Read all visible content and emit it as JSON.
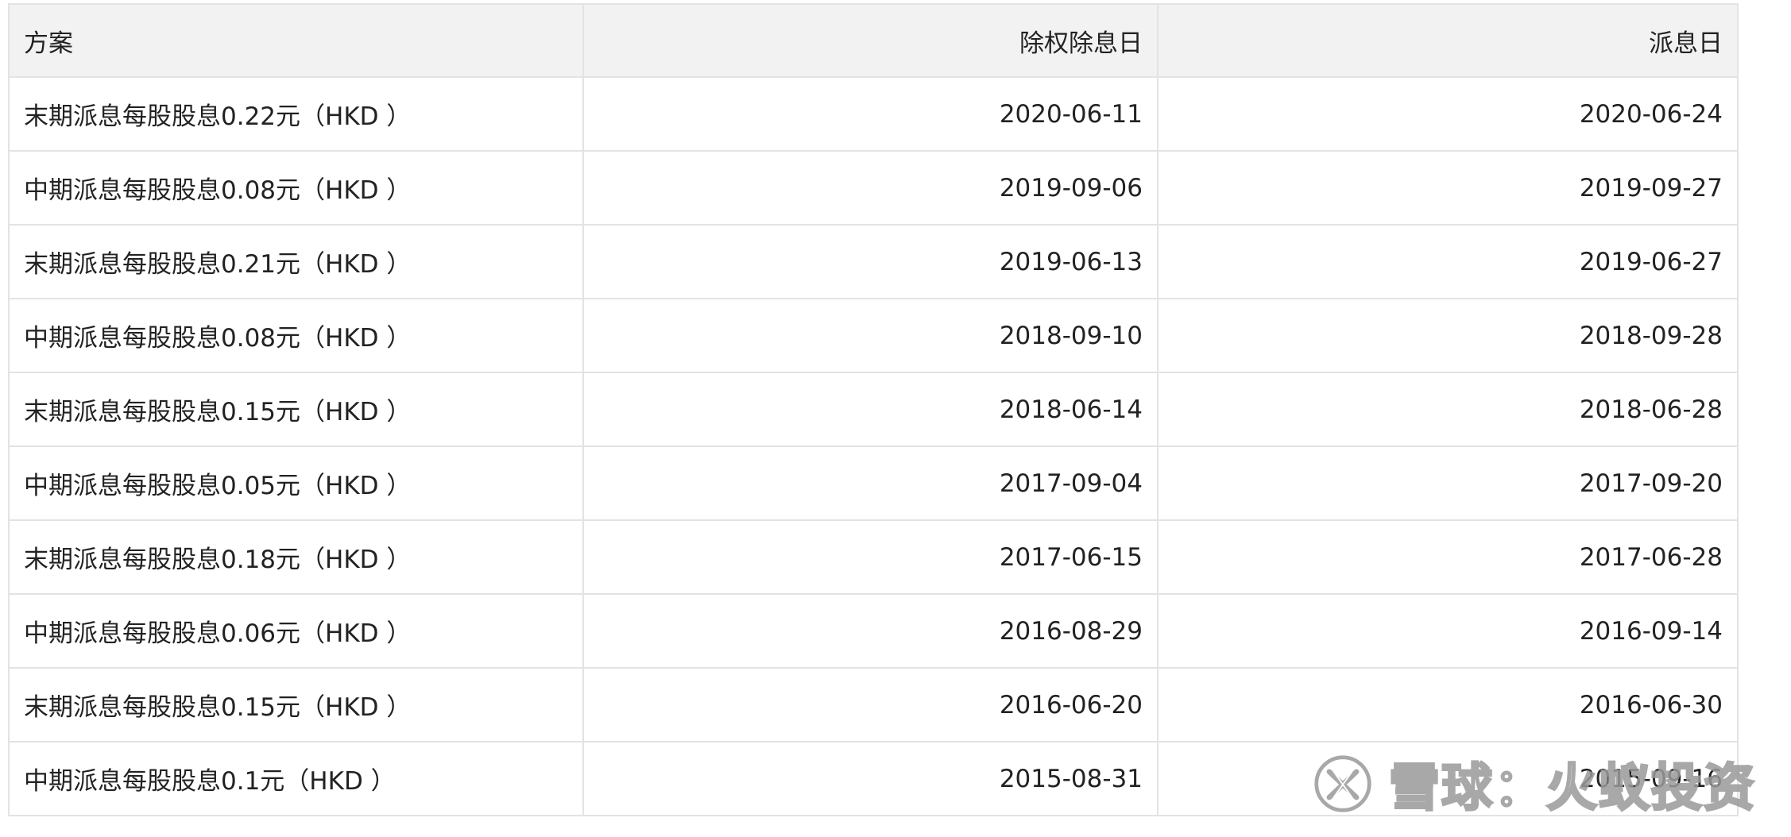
{
  "table": {
    "headers": {
      "plan": "方案",
      "ex_date": "除权除息日",
      "pay_date": "派息日"
    },
    "rows": [
      {
        "plan": "末期派息每股股息0.22元（HKD ）",
        "ex_date": "2020-06-11",
        "pay_date": "2020-06-24"
      },
      {
        "plan": "中期派息每股股息0.08元（HKD ）",
        "ex_date": "2019-09-06",
        "pay_date": "2019-09-27"
      },
      {
        "plan": "末期派息每股股息0.21元（HKD ）",
        "ex_date": "2019-06-13",
        "pay_date": "2019-06-27"
      },
      {
        "plan": "中期派息每股股息0.08元（HKD ）",
        "ex_date": "2018-09-10",
        "pay_date": "2018-09-28"
      },
      {
        "plan": "末期派息每股股息0.15元（HKD ）",
        "ex_date": "2018-06-14",
        "pay_date": "2018-06-28"
      },
      {
        "plan": "中期派息每股股息0.05元（HKD ）",
        "ex_date": "2017-09-04",
        "pay_date": "2017-09-20"
      },
      {
        "plan": "末期派息每股股息0.18元（HKD ）",
        "ex_date": "2017-06-15",
        "pay_date": "2017-06-28"
      },
      {
        "plan": "中期派息每股股息0.06元（HKD ）",
        "ex_date": "2016-08-29",
        "pay_date": "2016-09-14"
      },
      {
        "plan": "末期派息每股股息0.15元（HKD ）",
        "ex_date": "2016-06-20",
        "pay_date": "2016-06-30"
      },
      {
        "plan": "中期派息每股股息0.1元（HKD ）",
        "ex_date": "2015-08-31",
        "pay_date": "2015-09-16"
      }
    ]
  },
  "watermark": {
    "text": "雪球：火蚁投资",
    "logo_icon": "xueqiu-logo-icon",
    "color": "#9a9a9a"
  },
  "colors": {
    "header_bg": "#f2f2f2",
    "border": "#e3e3e3",
    "text": "#222222"
  }
}
